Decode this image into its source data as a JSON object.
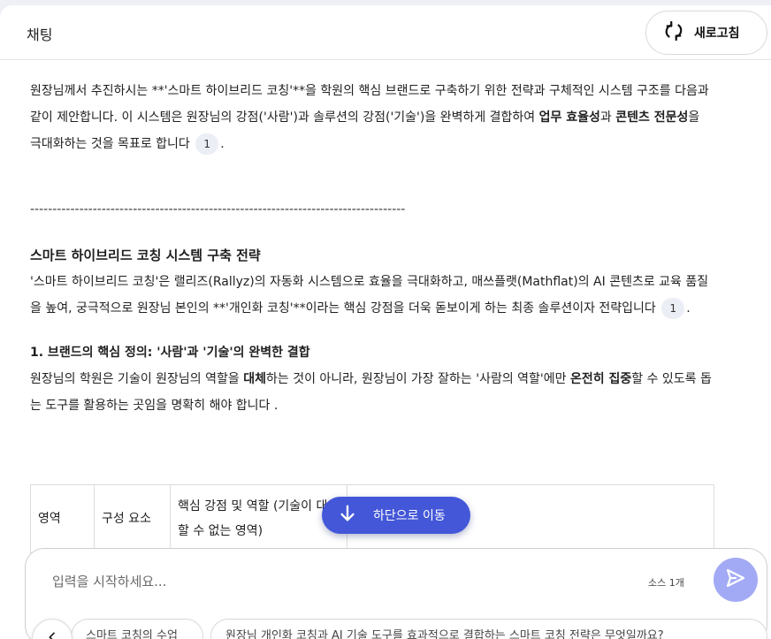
{
  "header": {
    "title": "채팅",
    "refresh_label": "새로고침"
  },
  "content": {
    "intro_parts": {
      "a": "원장님께서 추진하시는 **'스마트 하이브리드 코칭'**을 학원의 핵심 브랜드로 구축하기 위한 전략과 구체적인 시스템 구조를 다음과 같이 제안합니다. 이 시스템은 원장님의 강점('사람')과 솔루션의 강점('기술')을 완벽하게 결합하여 ",
      "b": "업무 효율성",
      "c": "과 ",
      "d": "콘텐츠 전문성",
      "e": "을 극대화하는 것을 목표로 합니다"
    },
    "cite1": "1",
    "divider": "------------------------------------------------------------------------------------",
    "section_title": "스마트 하이브리드 코칭 시스템 구축 전략",
    "para2": "'스마트 하이브리드 코칭'은 랠리즈(Rallyz)의 자동화 시스템으로 효율을 극대화하고, 매쓰플랫(Mathflat)의 AI 콘텐츠로 교육 품질을 높여, 궁극적으로 원장님 본인의 **'개인화 코칭'**이라는 핵심 강점을 더욱 돋보이게 하는 최종 솔루션이자 전략입니다",
    "cite2": "1",
    "sub_title": "1. 브랜드의 핵심 정의: '사람'과 '기술'의 완벽한 결합",
    "para3_parts": {
      "a": "원장님의 학원은 기술이 원장님의 역할을 ",
      "b": "대체",
      "c": "하는 것이 아니라, 원장님이 가장 잘하는 '사람의 역할'에만 ",
      "d": "온전히 집중",
      "e": "할 수 있도록 돕는 도구를 활용하는 곳임을 명확히 해야 합니다 ."
    },
    "table": {
      "col1": "영역",
      "col2": "구성 요소",
      "col3": "핵심 강점 및 역할 (기술이 대체할 수 없는 영역)",
      "col4": ""
    }
  },
  "scroll_button": {
    "label": "하단으로 이동"
  },
  "input": {
    "placeholder": "입력을 시작하세요...",
    "source_count": "소스 1개"
  },
  "suggestions": [
    "스마트 코칭의 수업",
    "원장님 개인화 코칭과 AI 기술 도구를 효과적으로 결합하는 스마트 코칭 전략은 무엇일까요?"
  ],
  "colors": {
    "accent": "#4357d8",
    "send": "#a3aaf5"
  }
}
